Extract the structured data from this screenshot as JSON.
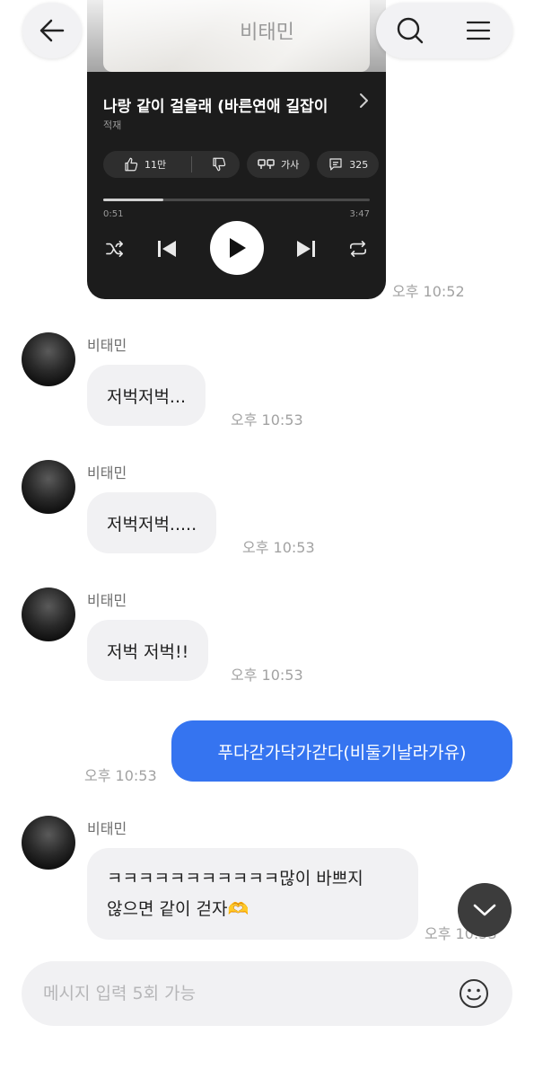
{
  "header": {
    "title": "비태민",
    "back_icon": "arrow-left-icon",
    "search_icon": "search-icon",
    "menu_icon": "hamburger-menu-icon"
  },
  "music_card": {
    "title": "나랑 같이 걸을래 (바른연애 길잡이",
    "artist": "적재",
    "likes": "11만",
    "lyrics_label": "가사",
    "comments": "325",
    "current_time": "0:51",
    "total_time": "3:47",
    "progress": 0.225,
    "timestamp": "오후 10:52"
  },
  "messages": [
    {
      "sender": "비태민",
      "text": "저벅저벅...",
      "time": "오후 10:53"
    },
    {
      "sender": "비태민",
      "text": "저벅저벅.....",
      "time": "오후 10:53"
    },
    {
      "sender": "비태민",
      "text": "저벅 저벅!!",
      "time": "오후 10:53"
    },
    {
      "text": "푸다갇가닥가갇다(비둘기날라가유)",
      "time": "오후 10:53",
      "outgoing": true
    },
    {
      "sender": "비태민",
      "line1": "ㅋㅋㅋㅋㅋㅋㅋㅋㅋㅋㅋ많이 바쁘지",
      "line2": "않으면 같이 걷자🫶",
      "time": "오후 10:53"
    }
  ],
  "input": {
    "placeholder": "메시지 입력 5회 가능",
    "value": ""
  },
  "colors": {
    "outgoing_bubble": "#3574f0",
    "incoming_bubble": "#f1f1f3",
    "card_bg": "#1c1c1c"
  }
}
